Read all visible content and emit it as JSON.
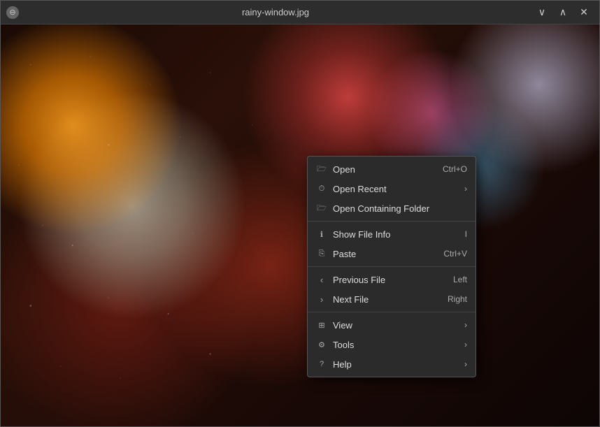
{
  "window": {
    "title": "rainy-window.jpg",
    "icon": "⊖",
    "controls": {
      "minimize": "∨",
      "maximize": "∧",
      "close": "✕"
    }
  },
  "contextMenu": {
    "items": [
      {
        "id": "open",
        "icon": "folder-open-icon",
        "iconChar": "📂",
        "label": "Open",
        "shortcut": "Ctrl+O",
        "hasSubmenu": false
      },
      {
        "id": "open-recent",
        "icon": "recent-icon",
        "iconChar": "🕐",
        "label": "Open Recent",
        "shortcut": "",
        "hasSubmenu": true
      },
      {
        "id": "open-folder",
        "icon": "folder-icon",
        "iconChar": "📁",
        "label": "Open Containing Folder",
        "shortcut": "",
        "hasSubmenu": false
      },
      {
        "id": "separator1",
        "type": "separator"
      },
      {
        "id": "show-info",
        "icon": "info-icon",
        "iconChar": "ℹ",
        "label": "Show File Info",
        "shortcut": "I",
        "hasSubmenu": false
      },
      {
        "id": "paste",
        "icon": "paste-icon",
        "iconChar": "📋",
        "label": "Paste",
        "shortcut": "Ctrl+V",
        "hasSubmenu": false
      },
      {
        "id": "separator2",
        "type": "separator"
      },
      {
        "id": "prev-file",
        "icon": "prev-icon",
        "iconChar": "‹",
        "label": "Previous File",
        "shortcut": "Left",
        "hasSubmenu": false,
        "hasLeftArrow": true
      },
      {
        "id": "next-file",
        "icon": "next-icon",
        "iconChar": "›",
        "label": "Next File",
        "shortcut": "Right",
        "hasSubmenu": false,
        "hasLeftArrow": true
      },
      {
        "id": "separator3",
        "type": "separator"
      },
      {
        "id": "view",
        "icon": "view-icon",
        "iconChar": "⊞",
        "label": "View",
        "shortcut": "",
        "hasSubmenu": true
      },
      {
        "id": "tools",
        "icon": "tools-icon",
        "iconChar": "⚙",
        "label": "Tools",
        "shortcut": "",
        "hasSubmenu": true
      },
      {
        "id": "help",
        "icon": "help-icon",
        "iconChar": "?",
        "label": "Help",
        "shortcut": "",
        "hasSubmenu": true
      }
    ]
  }
}
